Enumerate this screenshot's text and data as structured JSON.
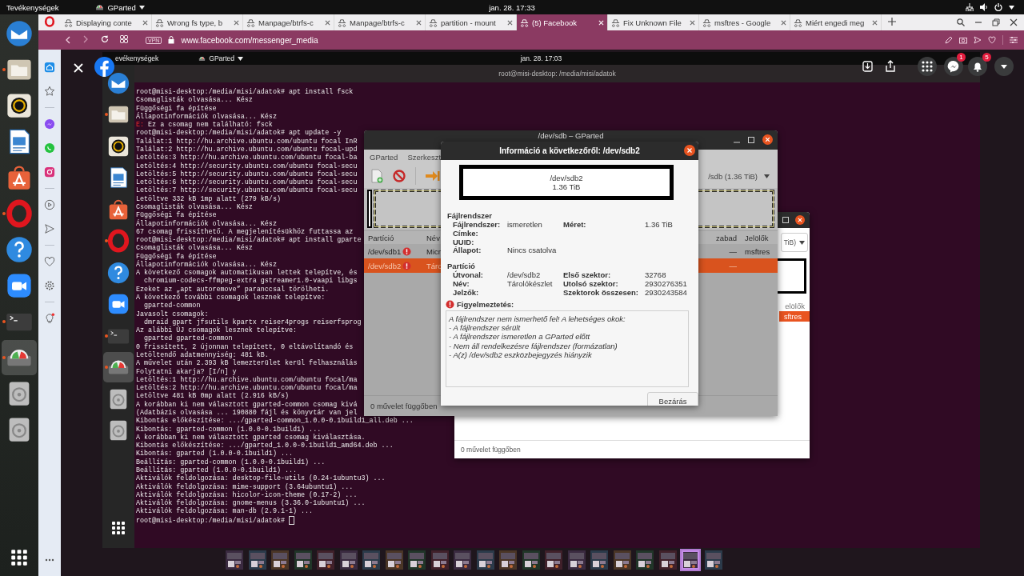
{
  "top_bar": {
    "activities": "Tevékenységek",
    "app_menu": "GParted",
    "clock": "jan. 28.  17:33"
  },
  "dock": [
    {
      "kind": "mail",
      "running": false,
      "active": false
    },
    {
      "kind": "files",
      "running": true,
      "active": false
    },
    {
      "kind": "music",
      "running": false,
      "active": false
    },
    {
      "kind": "writer",
      "running": false,
      "active": false
    },
    {
      "kind": "store",
      "running": false,
      "active": false
    },
    {
      "kind": "browser",
      "running": true,
      "active": false
    },
    {
      "kind": "help",
      "running": false,
      "active": false
    },
    {
      "kind": "video",
      "running": false,
      "active": false
    },
    {
      "kind": "terminal",
      "running": true,
      "active": false
    },
    {
      "kind": "partition",
      "running": true,
      "active": true
    },
    {
      "kind": "disc",
      "running": false,
      "active": false
    },
    {
      "kind": "disc",
      "running": false,
      "active": false
    }
  ],
  "browser": {
    "tabs": [
      {
        "title": "Displaying conte",
        "selected": false
      },
      {
        "title": "Wrong fs type, b",
        "selected": false
      },
      {
        "title": "Manpage/btrfs-c",
        "selected": false
      },
      {
        "title": "Manpage/btrfs-c",
        "selected": false
      },
      {
        "title": "partition - mount",
        "selected": false
      },
      {
        "title": "(5) Facebook",
        "selected": true
      },
      {
        "title": "Fix Unknown File",
        "selected": false
      },
      {
        "title": "msftres - Google",
        "selected": false
      },
      {
        "title": "Miért engedi meg",
        "selected": false
      }
    ],
    "vpn": "VPN",
    "url": "www.facebook.com/messenger_media",
    "sidebar": [
      {
        "kind": "home"
      },
      {
        "kind": "star"
      },
      {
        "kind": "separator"
      },
      {
        "kind": "messenger"
      },
      {
        "kind": "chat"
      },
      {
        "kind": "camera"
      },
      {
        "kind": "separator"
      },
      {
        "kind": "player"
      },
      {
        "kind": "send"
      },
      {
        "kind": "separator"
      },
      {
        "kind": "heart"
      },
      {
        "kind": "settings"
      },
      {
        "kind": "separator"
      },
      {
        "kind": "bulb"
      }
    ]
  },
  "viewer": {
    "messenger_badge": "1",
    "notification_badge": "5",
    "screenshot": {
      "top_bar": {
        "activities": "evékenységek",
        "app_menu": "GParted",
        "clock": "jan. 28.  17:03"
      },
      "dock": [
        {
          "kind": "mail",
          "running": false,
          "active": false
        },
        {
          "kind": "files",
          "running": true,
          "active": false
        },
        {
          "kind": "music",
          "running": false,
          "active": false
        },
        {
          "kind": "writer",
          "running": false,
          "active": false
        },
        {
          "kind": "store",
          "running": false,
          "active": false
        },
        {
          "kind": "browser",
          "running": true,
          "active": false
        },
        {
          "kind": "help",
          "running": false,
          "active": false
        },
        {
          "kind": "video",
          "running": false,
          "active": false
        },
        {
          "kind": "terminal",
          "running": true,
          "active": false
        },
        {
          "kind": "partition",
          "running": true,
          "active": true
        },
        {
          "kind": "disc",
          "running": false,
          "active": false
        },
        {
          "kind": "disc",
          "running": false,
          "active": false
        }
      ],
      "terminal": {
        "title": "root@misi-desktop: /media/misi/adatok",
        "lines": [
          "root@misi-desktop:/media/misi/adatok# apt install fsck",
          "Csomaglisták olvasása... Kész",
          "Függőségi fa építése",
          "Állapotinformációk olvasása... Kész",
          {
            "prefix": "E:",
            "text": "Ez a csomag nem található: fsck"
          },
          "root@misi-desktop:/media/misi/adatok# apt update -y",
          "Találat:1 http://hu.archive.ubuntu.com/ubuntu focal InR",
          "Találat:2 http://hu.archive.ubuntu.com/ubuntu focal-upd",
          "Letöltés:3 http://hu.archive.ubuntu.com/ubuntu focal-ba",
          "Letöltés:4 http://security.ubuntu.com/ubuntu focal-secu",
          "Letöltés:5 http://security.ubuntu.com/ubuntu focal-secu",
          "Letöltés:6 http://security.ubuntu.com/ubuntu focal-secu",
          "Letöltés:7 http://security.ubuntu.com/ubuntu focal-secu",
          "Letöltve 332 kB 1mp alatt (279 kB/s)",
          "Csomaglisták olvasása... Kész",
          "Függőségi fa építése",
          "Állapotinformációk olvasása... Kész",
          "67 csomag frissíthető. A megjelenítésükhöz futtassa az",
          "root@misi-desktop:/media/misi/adatok# apt install gparte",
          "Csomaglisták olvasása... Kész",
          "Függőségi fa építése",
          "Állapotinformációk olvasása... Kész",
          "A következő csomagok automatikusan lettek telepítve, és",
          "  chromium-codecs-ffmpeg-extra gstreamer1.0-vaapi libgs",
          "Ezeket az „apt autoremove” paranccsal törölheti.",
          "A következő további csomagok lesznek telepítve:",
          "  gparted-common",
          "Javasolt csomagok:",
          "  dmraid gpart jfsutils kpartx reiser4progs reiserfsprog",
          "Az alábbi ÚJ csomagok lesznek telepítve:",
          "  gparted gparted-common",
          "0 frissített, 2 újonnan telepített, 0 eltávolítandó és",
          "Letöltendő adatmennyiség: 481 kB.",
          "A művelet után 2.393 kB lemezterület kerül felhasználás",
          "Folytatni akarja? [I/n] y",
          "Letöltés:1 http://hu.archive.ubuntu.com/ubuntu focal/ma",
          "Letöltés:2 http://hu.archive.ubuntu.com/ubuntu focal/ma",
          "Letöltve 481 kB 0mp alatt (2.916 kB/s)",
          "A korábban ki nem választott gparted-common csomag kivá",
          "(Adatbázis olvasása ... 190880 fájl és könyvtár van jel",
          "Kibontás előkészítése: .../gparted-common_1.0.0-0.1build1_all.deb ...",
          "Kibontás: gparted-common (1.0.0-0.1build1) ...",
          "A korábban ki nem választott gparted csomag kiválasztása.",
          "Kibontás előkészítése: .../gparted_1.0.0-0.1build1_amd64.deb ...",
          "Kibontás: gparted (1.0.0-0.1build1) ...",
          "Beállítás: gparted-common (1.0.0-0.1build1) ...",
          "Beállítás: gparted (1.0.0-0.1build1) ...",
          "Aktiválók feldolgozása: desktop-file-utils (0.24-1ubuntu3) ...",
          "Aktiválók feldolgozása: mime-support (3.64ubuntu1) ...",
          "Aktiválók feldolgozása: hicolor-icon-theme (0.17-2) ...",
          "Aktiválók feldolgozása: gnome-menus (3.36.0-1ubuntu1) ...",
          "Aktiválók feldolgozása: man-db (2.9.1-1) ...",
          "root@misi-desktop:/media/misi/adatok#"
        ]
      },
      "gparted_main": {
        "title": "/dev/sdb – GParted",
        "menu": [
          "GParted",
          "Szerkeszt"
        ],
        "device": "/sdb (1.36 TiB)",
        "columns": [
          "Partíció",
          "Név",
          "zabad",
          "Jelölők"
        ],
        "rows": [
          {
            "partition": "/dev/sdb1",
            "warning": true,
            "name": "Micr",
            "column_3": "—",
            "flags": "msftres",
            "selected": false
          },
          {
            "partition": "/dev/sdb2",
            "warning": true,
            "name": "Táro",
            "column_3": "—",
            "flags": "",
            "selected": true
          }
        ],
        "status": "0 művelet függőben"
      },
      "gparted_second": {
        "device": "TiB)",
        "column": "elölők",
        "row": {
          "flags": "sftres",
          "selected": true
        },
        "status": "0 művelet függőben"
      },
      "dialog": {
        "title": "Információ a következőről: /dev/sdb2",
        "partition_name": "/dev/sdb2",
        "partition_size": "1.36 TiB",
        "sections": [
          {
            "title": "Fájlrendszer",
            "rows": [
              {
                "label": "Fájlrendszer:",
                "value": "ismeretlen",
                "label2": "Méret:",
                "value2": "1.36 TiB"
              },
              {
                "label": "Címke:"
              },
              {
                "label": "UUID:"
              },
              {
                "label": "Állapot:",
                "value": "Nincs csatolva"
              }
            ]
          },
          {
            "title": "Partíció",
            "rows": [
              {
                "label": "Útvonal:",
                "value": "/dev/sdb2",
                "label2": "Első szektor:",
                "value2": "32768"
              },
              {
                "label": "Név:",
                "value": "Tárolókészlet",
                "label2": "Utolsó szektor:",
                "value2": "2930276351"
              },
              {
                "label": "Jelzők:",
                "label2": "Szektorok összesen:",
                "value2": "2930243584"
              }
            ]
          }
        ],
        "warning": {
          "title": "Figyelmeztetés:",
          "lines": [
            "A fájlrendszer nem ismerhető fel! A lehetséges okok:",
            "- A fájlrendszer sérült",
            "- A fájlrendszer ismeretlen a GParted előtt",
            "- Nem áll rendelkezésre fájlrendszer (formázatlan)",
            "- A(z) /dev/sdb2 eszközbejegyzés hiányzik"
          ]
        },
        "button": "Bezárás"
      }
    },
    "thumbnails": [
      {
        "kind": "picture",
        "selected": false
      },
      {
        "kind": "picture",
        "selected": false
      },
      {
        "kind": "picture",
        "selected": false
      },
      {
        "kind": "picture",
        "selected": false
      },
      {
        "kind": "picture",
        "selected": false
      },
      {
        "kind": "picture",
        "selected": false
      },
      {
        "kind": "picture",
        "selected": false
      },
      {
        "kind": "picture",
        "selected": false
      },
      {
        "kind": "picture",
        "selected": false
      },
      {
        "kind": "picture",
        "selected": false
      },
      {
        "kind": "picture",
        "selected": false
      },
      {
        "kind": "picture",
        "selected": false
      },
      {
        "kind": "picture",
        "selected": false
      },
      {
        "kind": "picture",
        "selected": false
      },
      {
        "kind": "picture",
        "selected": false
      },
      {
        "kind": "picture",
        "selected": false
      },
      {
        "kind": "picture",
        "selected": false
      },
      {
        "kind": "picture",
        "selected": false
      },
      {
        "kind": "picture",
        "selected": false
      },
      {
        "kind": "picture",
        "selected": false
      },
      {
        "kind": "picture",
        "selected": true
      },
      {
        "kind": "picture",
        "selected": false
      }
    ]
  }
}
